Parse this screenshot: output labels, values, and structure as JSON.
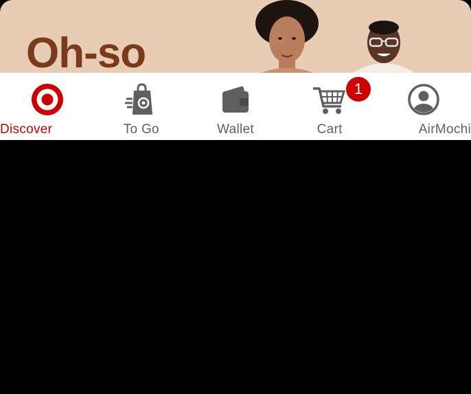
{
  "banner": {
    "headline": "Oh-so",
    "background_color": "#e8ccb4",
    "headline_color": "#7a3a1c"
  },
  "tabbar": {
    "active_color": "#cc0000",
    "inactive_color": "#5f5f5f",
    "tabs": [
      {
        "label": "Discover",
        "icon": "target-bullseye-icon",
        "active": true
      },
      {
        "label": "To Go",
        "icon": "shopping-bag-pickup-icon",
        "active": false
      },
      {
        "label": "Wallet",
        "icon": "wallet-icon",
        "active": false
      },
      {
        "label": "Cart",
        "icon": "shopping-cart-icon",
        "active": false,
        "badge": "1"
      },
      {
        "label": "AirMochi",
        "icon": "account-circle-icon",
        "active": false
      }
    ]
  }
}
